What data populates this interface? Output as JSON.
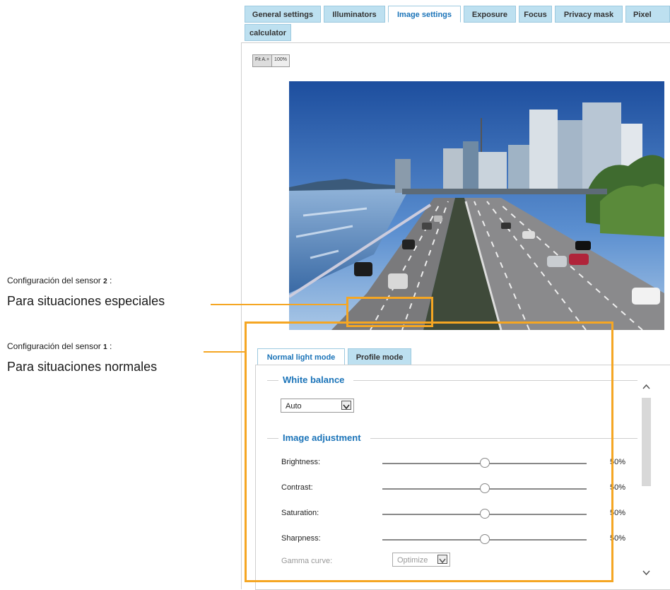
{
  "tabs": [
    {
      "label": "General settings",
      "active": false
    },
    {
      "label": "Illuminators",
      "active": false
    },
    {
      "label": "Image settings",
      "active": true
    },
    {
      "label": "Exposure",
      "active": false
    },
    {
      "label": "Focus",
      "active": false
    },
    {
      "label": "Privacy mask",
      "active": false
    },
    {
      "label": "Pixel",
      "active": false
    },
    {
      "label": "calculator",
      "active": false
    }
  ],
  "zoom": {
    "fit_label": "Fit A.+",
    "full_label": "100%"
  },
  "callouts": {
    "sensor2": {
      "heading": "Configuración del sensor",
      "number": "2",
      "colon": ":",
      "desc": "Para situaciones especiales"
    },
    "sensor1": {
      "heading": "Configuración del sensor",
      "number": "1",
      "colon": ":",
      "desc": "Para situaciones normales"
    }
  },
  "subtabs": [
    {
      "label": "Normal light mode",
      "active": true
    },
    {
      "label": "Profile mode",
      "active": false
    }
  ],
  "white_balance": {
    "title": "White balance",
    "value": "Auto"
  },
  "image_adjustment": {
    "title": "Image adjustment",
    "rows": [
      {
        "label": "Brightness:",
        "value": "50%",
        "level": 0.5
      },
      {
        "label": "Contrast:",
        "value": "50%",
        "level": 0.5
      },
      {
        "label": "Saturation:",
        "value": "50%",
        "level": 0.5
      },
      {
        "label": "Sharpness:",
        "value": "50%",
        "level": 0.5
      }
    ],
    "gamma": {
      "label": "Gamma curve:",
      "value": "Optimize"
    }
  },
  "colors": {
    "accent": "#1a73b8",
    "tab_bg": "#bde0f0",
    "highlight": "#f5a623"
  }
}
